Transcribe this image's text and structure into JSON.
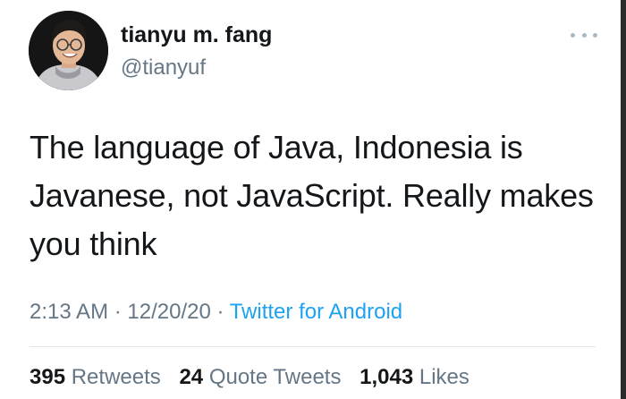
{
  "author": {
    "display_name": "tianyu m. fang",
    "handle": "@tianyuf",
    "avatar": "profile-photo"
  },
  "more_icon": "more-options-icon",
  "tweet": {
    "lines": [
      "The language of Java, Indonesia is",
      "Javanese, not JavaScript. Really makes",
      "you think"
    ]
  },
  "meta": {
    "time": "2:13 AM",
    "sep1": " · ",
    "date": "12/20/20",
    "sep2": " · ",
    "source": "Twitter for Android"
  },
  "stats": {
    "retweets_count": "395",
    "retweets_label": "Retweets",
    "quotes_count": "24",
    "quotes_label": "Quote Tweets",
    "likes_count": "1,043",
    "likes_label": "Likes"
  },
  "colors": {
    "link": "#1da1f2",
    "secondary": "#657786",
    "primary": "#14171a",
    "divider": "#e1e8ed"
  }
}
